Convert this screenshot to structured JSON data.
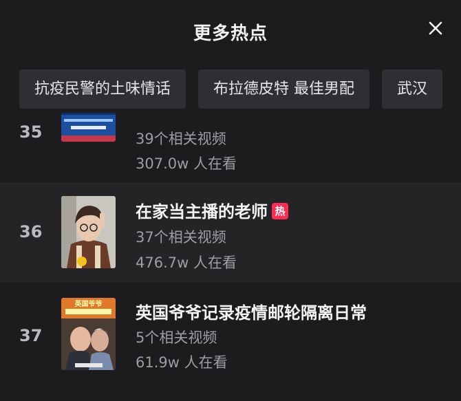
{
  "header": {
    "title": "更多热点",
    "close_icon": "close-icon"
  },
  "chips": [
    {
      "label": "抗疫民警的土味情话"
    },
    {
      "label": "布拉德皮特 最佳男配"
    },
    {
      "label": "武汉"
    }
  ],
  "items": [
    {
      "rank": "35",
      "title": "",
      "videos": "39个相关视频",
      "viewers": "307.0w 人在看",
      "badge": ""
    },
    {
      "rank": "36",
      "title": "在家当主播的老师",
      "videos": "37个相关视频",
      "viewers": "476.7w 人在看",
      "badge": "热"
    },
    {
      "rank": "37",
      "title": "英国爷爷记录疫情邮轮隔离日常",
      "videos": "5个相关视频",
      "viewers": "61.9w 人在看",
      "badge": ""
    }
  ],
  "thumb_captions": {
    "item_37_top": "英国爷爷"
  },
  "colors": {
    "background": "#1c1c1f",
    "chip": "#2e2e33",
    "highlight_row": "#242427",
    "hot_badge": "#fe2c55",
    "meta_text": "#9d9da4"
  }
}
